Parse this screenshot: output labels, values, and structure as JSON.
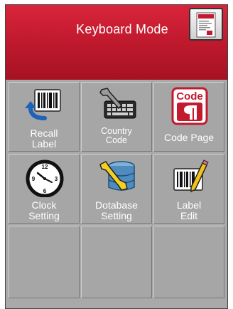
{
  "header": {
    "title": "Keyboard Mode"
  },
  "colors": {
    "header_red": "#c21a2f",
    "tile_gray": "#a6a6a6",
    "label_white": "#ffffff"
  },
  "menu": {
    "items": [
      {
        "line1": "Recall",
        "line2": "Label",
        "icon": "barcode-recall-icon"
      },
      {
        "line1": "Country",
        "line2": "Code",
        "icon": "wrench-keyboard-icon"
      },
      {
        "line1": "Code Page",
        "line2": "",
        "icon": "code-page-icon"
      },
      {
        "line1": "Clock",
        "line2": "Setting",
        "icon": "clock-icon"
      },
      {
        "line1": "Dotabase",
        "line2": "Setting",
        "icon": "database-wrench-icon"
      },
      {
        "line1": "Label",
        "line2": "Edit",
        "icon": "barcode-pencil-icon"
      }
    ]
  }
}
